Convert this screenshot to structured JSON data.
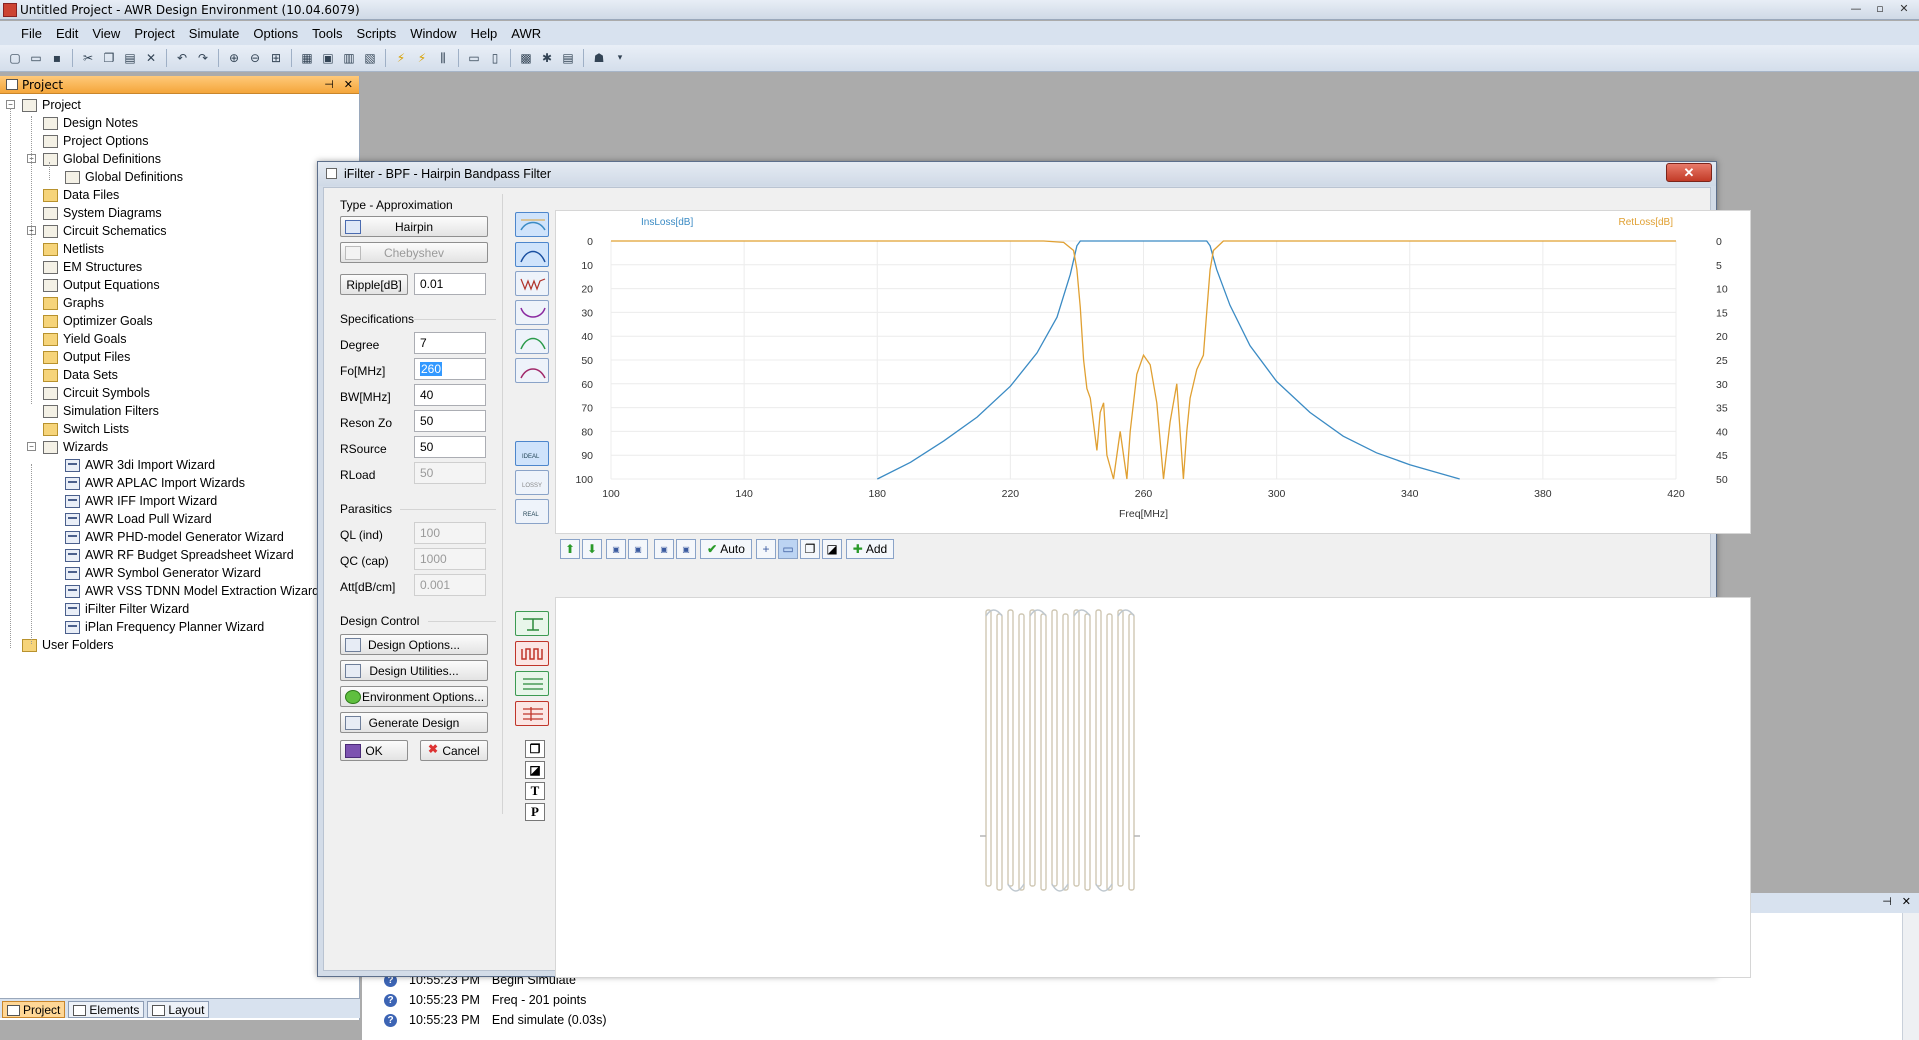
{
  "window": {
    "title": "Untitled Project - AWR Design Environment (10.04.6079)",
    "buttons": {
      "minimize": "—",
      "restore": "▫",
      "close": "✕"
    }
  },
  "menu": [
    "File",
    "Edit",
    "View",
    "Project",
    "Simulate",
    "Options",
    "Tools",
    "Scripts",
    "Window",
    "Help",
    "AWR"
  ],
  "project_panel": {
    "title": "Project",
    "pin": "⊣",
    "close": "✕",
    "tree": [
      {
        "label": "Project",
        "level": 0
      },
      {
        "label": "Design Notes",
        "level": 1
      },
      {
        "label": "Project Options",
        "level": 1
      },
      {
        "label": "Global Definitions",
        "level": 1
      },
      {
        "label": "Global Definitions",
        "level": 2
      },
      {
        "label": "Data Files",
        "level": 1
      },
      {
        "label": "System Diagrams",
        "level": 1
      },
      {
        "label": "Circuit Schematics",
        "level": 1
      },
      {
        "label": "Netlists",
        "level": 1
      },
      {
        "label": "EM Structures",
        "level": 1
      },
      {
        "label": "Output Equations",
        "level": 1
      },
      {
        "label": "Graphs",
        "level": 1
      },
      {
        "label": "Optimizer Goals",
        "level": 1
      },
      {
        "label": "Yield Goals",
        "level": 1
      },
      {
        "label": "Output Files",
        "level": 1
      },
      {
        "label": "Data Sets",
        "level": 1
      },
      {
        "label": "Circuit Symbols",
        "level": 1
      },
      {
        "label": "Simulation Filters",
        "level": 1
      },
      {
        "label": "Switch Lists",
        "level": 1
      },
      {
        "label": "Wizards",
        "level": 1
      },
      {
        "label": "AWR 3di Import Wizard",
        "level": 2
      },
      {
        "label": "AWR APLAC Import Wizards",
        "level": 2
      },
      {
        "label": "AWR IFF Import Wizard",
        "level": 2
      },
      {
        "label": "AWR Load Pull Wizard",
        "level": 2
      },
      {
        "label": "AWR PHD-model Generator Wizard",
        "level": 2
      },
      {
        "label": "AWR RF Budget Spreadsheet Wizard",
        "level": 2
      },
      {
        "label": "AWR Symbol Generator Wizard",
        "level": 2
      },
      {
        "label": "AWR VSS TDNN Model Extraction Wizard",
        "level": 2
      },
      {
        "label": "iFilter Filter Wizard",
        "level": 2
      },
      {
        "label": "iPlan Frequency Planner Wizard",
        "level": 2
      },
      {
        "label": "User Folders",
        "level": 0
      }
    ],
    "bottom_tabs": [
      "Project",
      "Elements",
      "Layout"
    ]
  },
  "log": {
    "pin": "⊣",
    "close": "✕",
    "rows": [
      {
        "time": "10:55:23 PM",
        "msg": "Begin Simulate"
      },
      {
        "time": "10:55:23 PM",
        "msg": "Freq - 201 points"
      },
      {
        "time": "10:55:23 PM",
        "msg": "End simulate (0.03s)"
      }
    ]
  },
  "dialog": {
    "title": "iFilter - BPF - Hairpin Bandpass Filter",
    "close": "✕",
    "type_section": {
      "heading": "Type - Approximation",
      "type_button": "Hairpin",
      "approx_button": "Chebyshev",
      "ripple_button": "Ripple[dB]",
      "ripple_value": "0.01"
    },
    "specs": {
      "heading": "Specifications",
      "rows": [
        {
          "label": "Degree",
          "value": "7",
          "disabled": false
        },
        {
          "label": "Fo[MHz]",
          "value": "260",
          "disabled": false,
          "selected": true
        },
        {
          "label": "BW[MHz]",
          "value": "40",
          "disabled": false
        },
        {
          "label": "Reson Zo",
          "value": "50",
          "disabled": false
        },
        {
          "label": "RSource",
          "value": "50",
          "disabled": false
        },
        {
          "label": "RLoad",
          "value": "50",
          "disabled": true
        }
      ]
    },
    "parasitics": {
      "heading": "Parasitics",
      "rows": [
        {
          "label": "QL (ind)",
          "value": "100"
        },
        {
          "label": "QC (cap)",
          "value": "1000"
        },
        {
          "label": "Att[dB/cm]",
          "value": "0.001"
        }
      ]
    },
    "design_control": {
      "heading": "Design Control",
      "options": "Design Options...",
      "utilities": "Design Utilities...",
      "environment": "Environment Options...",
      "generate": "Generate Design",
      "ok": "OK",
      "cancel": "Cancel"
    },
    "side_tools_labels": {
      "ideal": "IDEAL",
      "lossy": "LOSSY",
      "real": "REAL"
    },
    "chart_toolbar": {
      "auto": "Auto",
      "add": "Add"
    },
    "layout_tools": [
      "T",
      "P"
    ]
  },
  "chart_data": {
    "type": "line",
    "xlabel": "Freq[MHz]",
    "ylabel": "InsLoss[dB]",
    "y2label": "RetLoss[dB]",
    "xlim": [
      100,
      420
    ],
    "ylim": [
      0,
      100
    ],
    "y2lim": [
      0,
      50
    ],
    "x_ticks": [
      100,
      140,
      180,
      220,
      260,
      300,
      340,
      380,
      420
    ],
    "y_ticks": [
      0,
      10,
      20,
      30,
      40,
      50,
      60,
      70,
      80,
      90,
      100
    ],
    "y2_ticks": [
      0,
      5,
      10,
      15,
      20,
      25,
      30,
      35,
      40,
      45,
      50
    ],
    "y_inverted": true,
    "grid": true,
    "series": [
      {
        "name": "InsLoss[dB]",
        "color": "#3b8bc4",
        "axis": "left",
        "x": [
          180,
          190,
          200,
          210,
          220,
          228,
          234,
          238,
          240,
          241,
          245,
          260,
          275,
          279,
          280,
          282,
          286,
          292,
          300,
          310,
          320,
          330,
          340,
          350,
          355
        ],
        "y": [
          100,
          93,
          84,
          74,
          61,
          47,
          32,
          14,
          2,
          0,
          0,
          0,
          0,
          0,
          2,
          12,
          27,
          44,
          59,
          72,
          82,
          89,
          94,
          98,
          100
        ]
      },
      {
        "name": "RetLoss[dB]",
        "color": "#e0a032",
        "axis": "right",
        "x": [
          100,
          230,
          236,
          239,
          240,
          241,
          242,
          243,
          244,
          246,
          247,
          248,
          249,
          251,
          253,
          255,
          256,
          258,
          260,
          262,
          264,
          266,
          268,
          270,
          272,
          273,
          274,
          276,
          278,
          279,
          280,
          281,
          284,
          300,
          420
        ],
        "y": [
          0,
          0,
          0.3,
          2,
          6,
          14,
          25,
          31,
          33,
          44,
          36,
          34,
          45,
          50,
          40,
          50,
          40,
          28,
          24,
          26,
          34,
          50,
          38,
          30,
          50,
          40,
          33,
          27,
          24,
          15,
          6,
          2,
          0,
          0,
          0
        ]
      }
    ]
  }
}
